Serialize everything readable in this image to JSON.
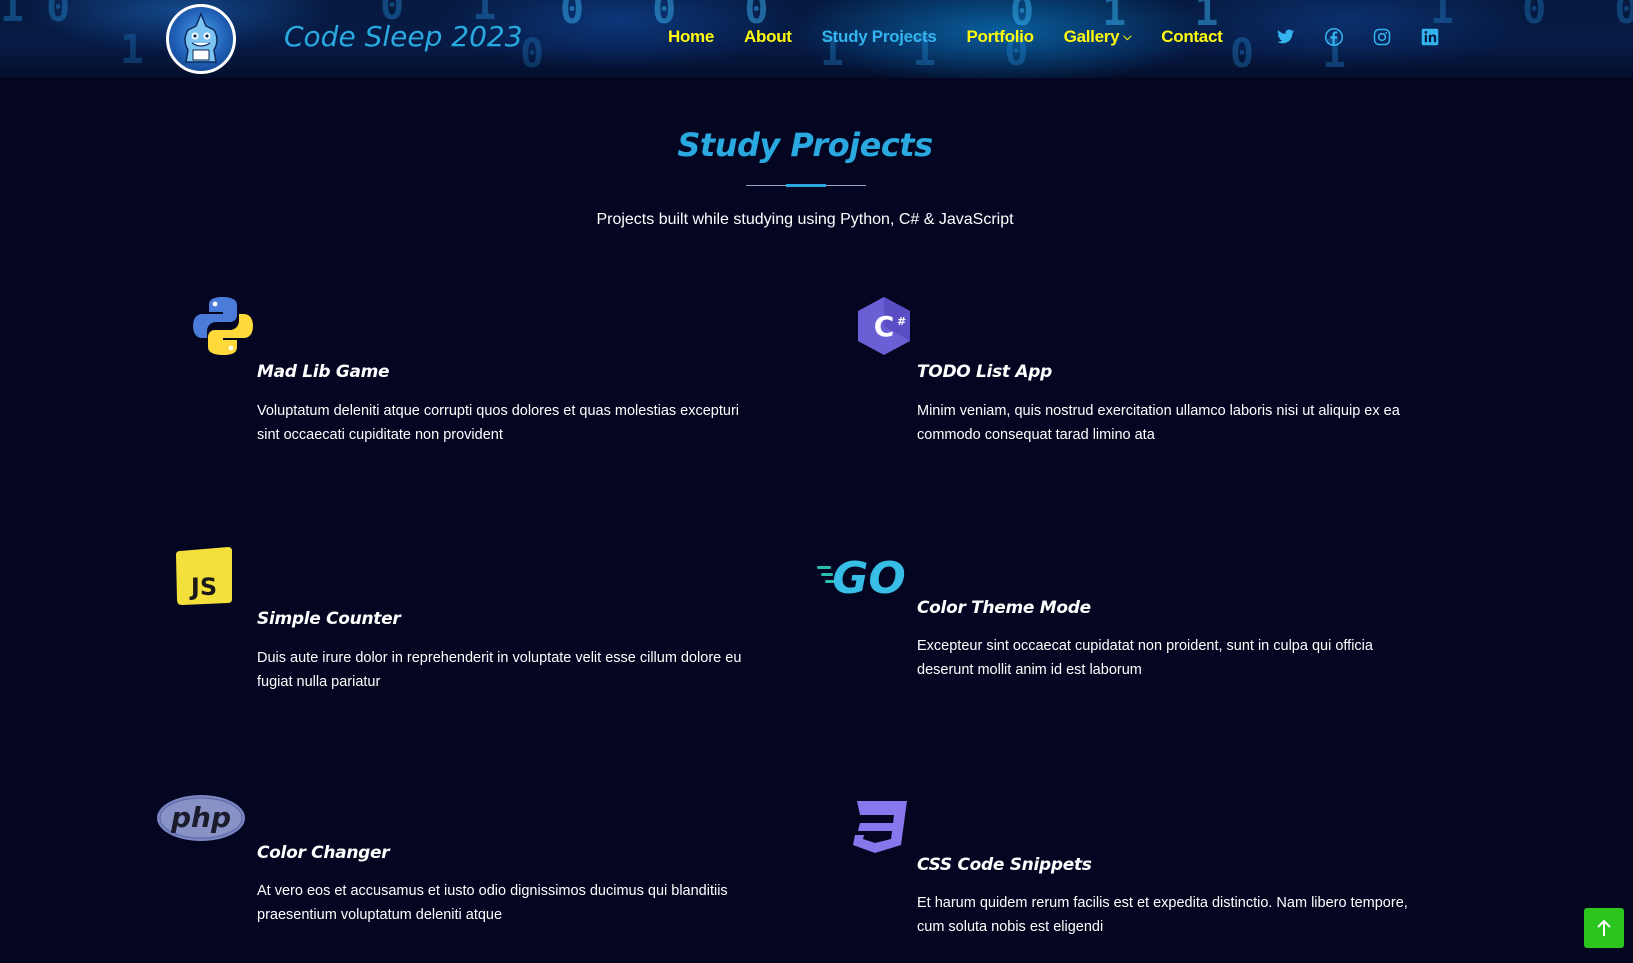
{
  "header": {
    "site_title": "Code Sleep 2023",
    "logo_icon": "shark-mascot-logo",
    "nav": [
      {
        "label": "Home",
        "active": false
      },
      {
        "label": "About",
        "active": false
      },
      {
        "label": "Study Projects",
        "active": true
      },
      {
        "label": "Portfolio",
        "active": false
      },
      {
        "label": "Gallery",
        "active": false,
        "dropdown": true
      },
      {
        "label": "Contact",
        "active": false
      }
    ],
    "socials": [
      "twitter-icon",
      "facebook-icon",
      "instagram-icon",
      "linkedin-icon"
    ],
    "colors": {
      "nav": "#fffb0b",
      "nav_active": "#34b4ef",
      "social": "#34b4ef"
    }
  },
  "section": {
    "title": "Study Projects",
    "subtitle": "Projects built while studying using Python, C# & JavaScript"
  },
  "projects": [
    {
      "icon": "python-icon",
      "title": "Mad Lib Game",
      "description": "Voluptatum deleniti atque corrupti quos dolores et quas molestias excepturi sint occaecati cupiditate non provident"
    },
    {
      "icon": "csharp-icon",
      "title": "TODO List App",
      "description": "Minim veniam, quis nostrud exercitation ullamco laboris nisi ut aliquip ex ea commodo consequat tarad limino ata"
    },
    {
      "icon": "javascript-icon",
      "title": "Simple Counter",
      "description": "Duis aute irure dolor in reprehenderit in voluptate velit esse cillum dolore eu fugiat nulla pariatur"
    },
    {
      "icon": "go-icon",
      "title": "Color Theme Mode",
      "description": "Excepteur sint occaecat cupidatat non proident, sunt in culpa qui officia deserunt mollit anim id est laborum"
    },
    {
      "icon": "php-icon",
      "title": "Color Changer",
      "description": "At vero eos et accusamus et iusto odio dignissimos ducimus qui blanditiis praesentium voluptatum deleniti atque"
    },
    {
      "icon": "css3-icon",
      "title": "CSS Code Snippets",
      "description": "Et harum quidem rerum facilis est et expedita distinctio. Nam libero tempore, cum soluta nobis est eligendi"
    }
  ],
  "back_to_top": {
    "icon": "arrow-up-icon",
    "color": "#2bc51e"
  }
}
